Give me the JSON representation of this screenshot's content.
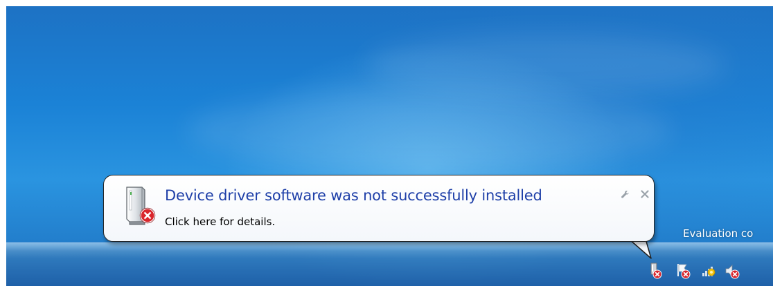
{
  "balloon": {
    "title": "Device driver software was not successfully installed",
    "message": "Click here for details.",
    "icon": "device-error-icon",
    "options_icon": "wrench-icon",
    "close_icon": "close-icon"
  },
  "desktop": {
    "watermark": "Evaluation co"
  },
  "tray": {
    "icons": [
      "device-error-icon",
      "action-center-flag-error-icon",
      "network-icon",
      "volume-muted-icon"
    ]
  },
  "colors": {
    "title": "#1e3fa8",
    "desktop": "#1b82d6",
    "error": "#d9262c"
  }
}
